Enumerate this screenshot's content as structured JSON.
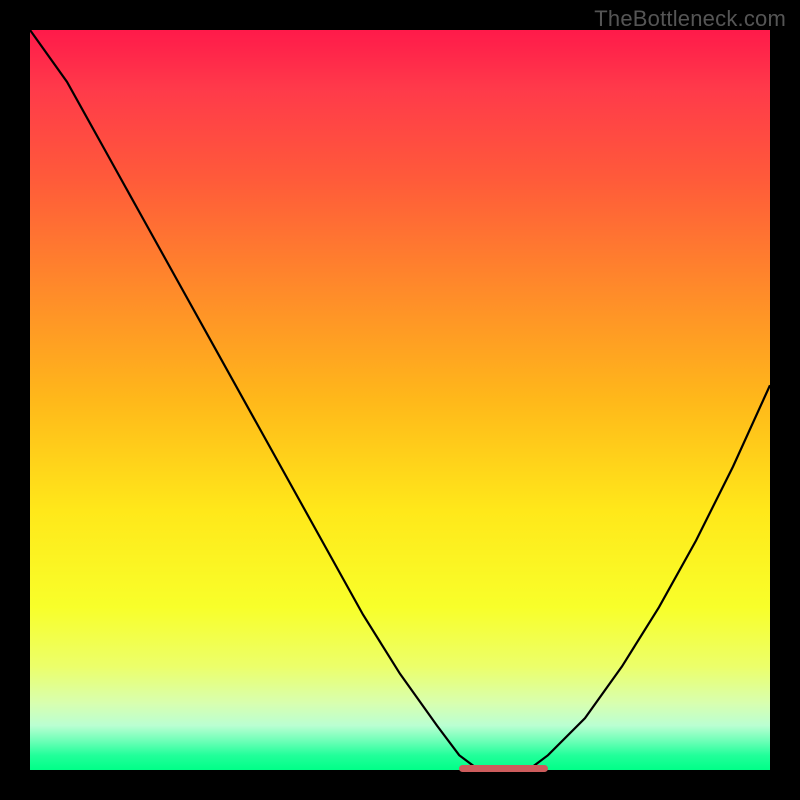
{
  "watermark": "TheBottleneck.com",
  "colors": {
    "gradient_top": "#ff1a4a",
    "gradient_bottom": "#00ff88",
    "curve": "#000000",
    "flat_marker": "#cd5c5c",
    "frame": "#000000"
  },
  "chart_data": {
    "type": "line",
    "title": "",
    "xlabel": "",
    "ylabel": "",
    "xlim": [
      0,
      100
    ],
    "ylim": [
      0,
      100
    ],
    "grid": false,
    "series": [
      {
        "name": "bottleneck-curve",
        "x": [
          0,
          5,
          10,
          15,
          20,
          25,
          30,
          35,
          40,
          45,
          50,
          55,
          58,
          60,
          63,
          66,
          68,
          70,
          75,
          80,
          85,
          90,
          95,
          100
        ],
        "y": [
          100,
          93,
          84,
          75,
          66,
          57,
          48,
          39,
          30,
          21,
          13,
          6,
          2,
          0.5,
          0,
          0,
          0.5,
          2,
          7,
          14,
          22,
          31,
          41,
          52
        ]
      }
    ],
    "markers": [
      {
        "name": "optimal-flat-region",
        "x_start": 58,
        "x_end": 70,
        "y": 0
      }
    ],
    "background_gradient": {
      "orientation": "vertical",
      "stops": [
        {
          "pos": 0.0,
          "color": "#ff1a4a"
        },
        {
          "pos": 0.5,
          "color": "#ffe81a"
        },
        {
          "pos": 1.0,
          "color": "#00ff88"
        }
      ]
    }
  }
}
